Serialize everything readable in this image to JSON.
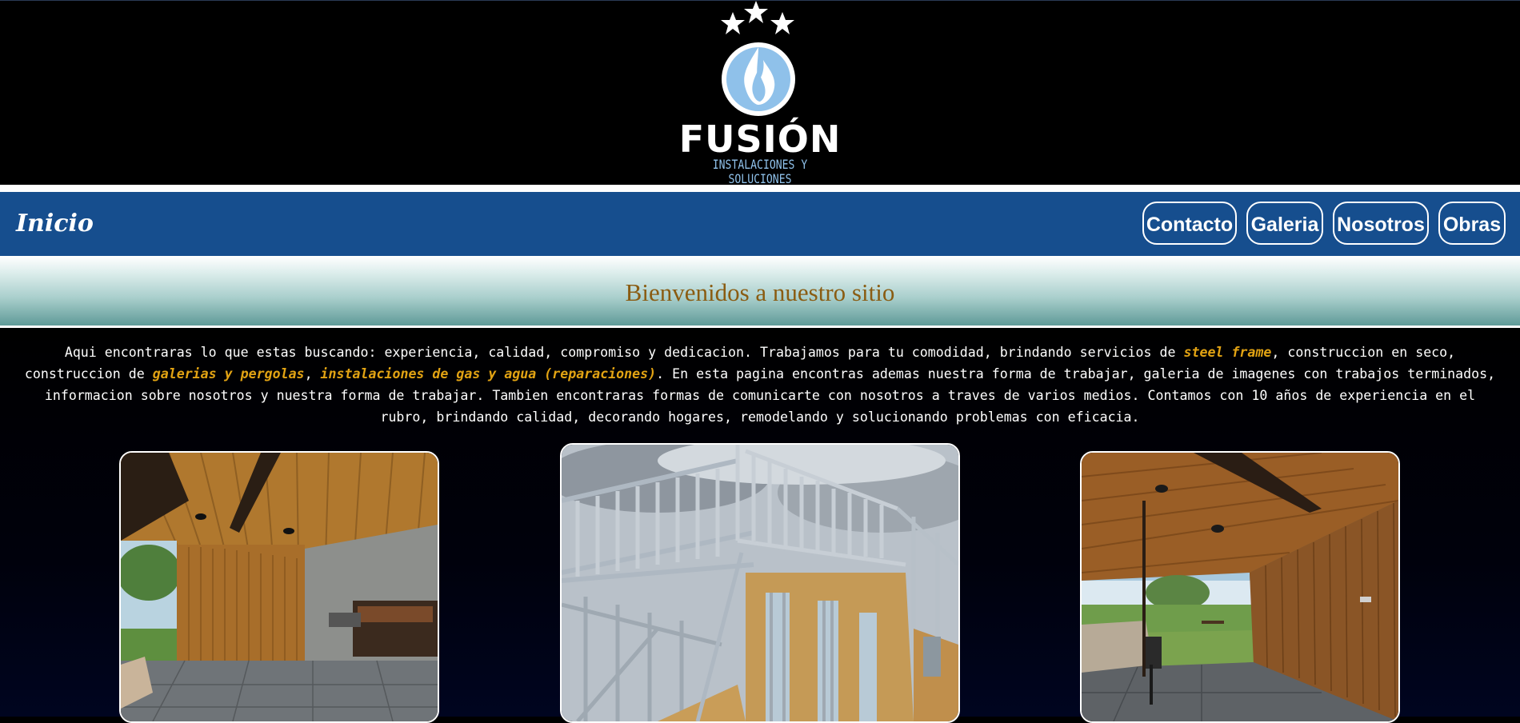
{
  "logo": {
    "title": "FUSIÓN",
    "subtitle": "INSTALACIONES Y SOLUCIONES",
    "icon": "flame-icon",
    "colors": {
      "flame": "#8fc1ea",
      "stars": "#ffffff"
    }
  },
  "nav": {
    "brand": "Inicio",
    "items": [
      {
        "label": "Contacto"
      },
      {
        "label": "Galeria"
      },
      {
        "label": "Nosotros"
      },
      {
        "label": "Obras"
      }
    ],
    "background": "#164e8e"
  },
  "welcome": {
    "title": "Bienvenidos a nuestro sitio"
  },
  "intro": {
    "part1": "Aqui encontraras lo que estas buscando: experiencia, calidad, compromiso y dedicacion. Trabajamos para tu comodidad, brindando servicios de ",
    "highlight1": "steel frame",
    "part2": ", construccion en seco, construccion de ",
    "highlight2": "galerias y pergolas",
    "part3": ", ",
    "highlight3": "instalaciones de gas y agua (reparaciones)",
    "part4": ". En esta pagina encontras ademas nuestra forma de trabajar, galeria de imagenes con trabajos terminados, informacion sobre nosotros y nuestra forma de trabajar. Tambien encontraras formas de comunicarte con nosotros a traves de varios medios. Contamos con 10 años de experiencia en el rubro, brindando calidad, decorando hogares, remodelando y solucionando problemas con eficacia.",
    "highlight_color": "#e2a313"
  },
  "gallery": [
    {
      "name": "galeria-madera"
    },
    {
      "name": "estructura-steel-frame"
    },
    {
      "name": "galeria-exterior"
    }
  ]
}
